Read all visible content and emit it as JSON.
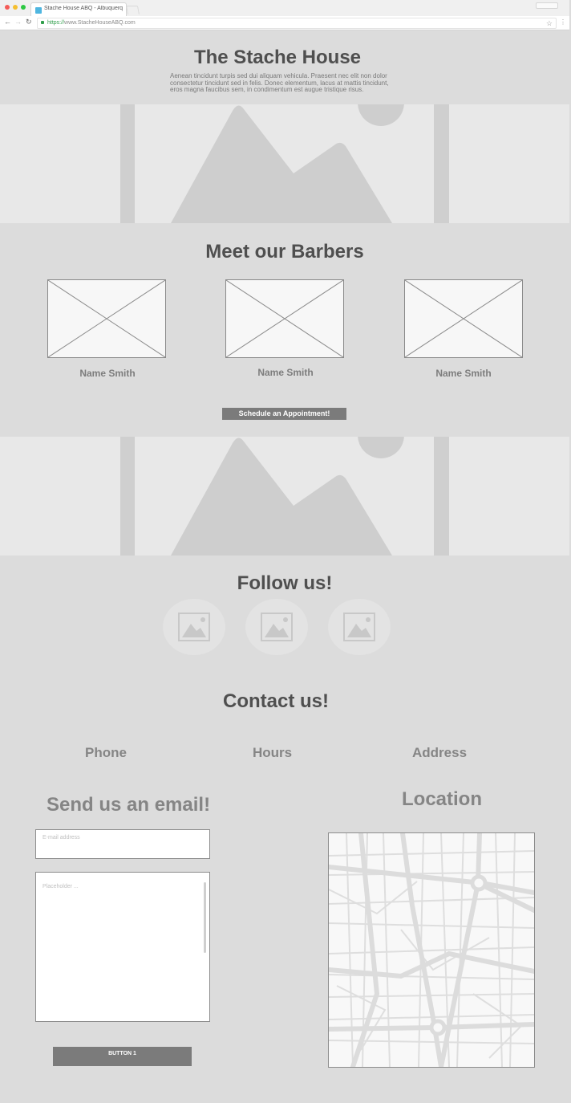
{
  "browser": {
    "tab_title": "Stache House ABQ - Albuquerque",
    "url_protocol": "https://",
    "url_rest": "www.StacheHouseABQ.com"
  },
  "header": {
    "title": "The Stache House",
    "description": "Aenean tincidunt turpis sed dui aliquam vehicula. Praesent nec elit non dolor consectetur tincidunt sed in felis. Donec elementum, lacus at mattis tincidunt, eros magna faucibus sem, in condimentum est augue tristique risus."
  },
  "barbers": {
    "heading": "Meet our Barbers",
    "names": [
      "Name Smith",
      "Name Smith",
      "Name Smith"
    ],
    "cta_label": "Schedule an Appointment!"
  },
  "follow": {
    "heading": "Follow us!"
  },
  "contact": {
    "heading": "Contact us!",
    "phone_label": "Phone",
    "hours_label": "Hours",
    "address_label": "Address"
  },
  "email_form": {
    "heading": "Send us an email!",
    "email_placeholder": "E-mail address",
    "message_placeholder": "Placeholder ...",
    "button_label": "BUTTON 1"
  },
  "location": {
    "heading": "Location"
  },
  "colors": {
    "page_bg": "#dcdcdc",
    "heading_dark": "#4f4f4f",
    "heading_grey": "#858585",
    "button_bg": "#7b7b7b"
  }
}
